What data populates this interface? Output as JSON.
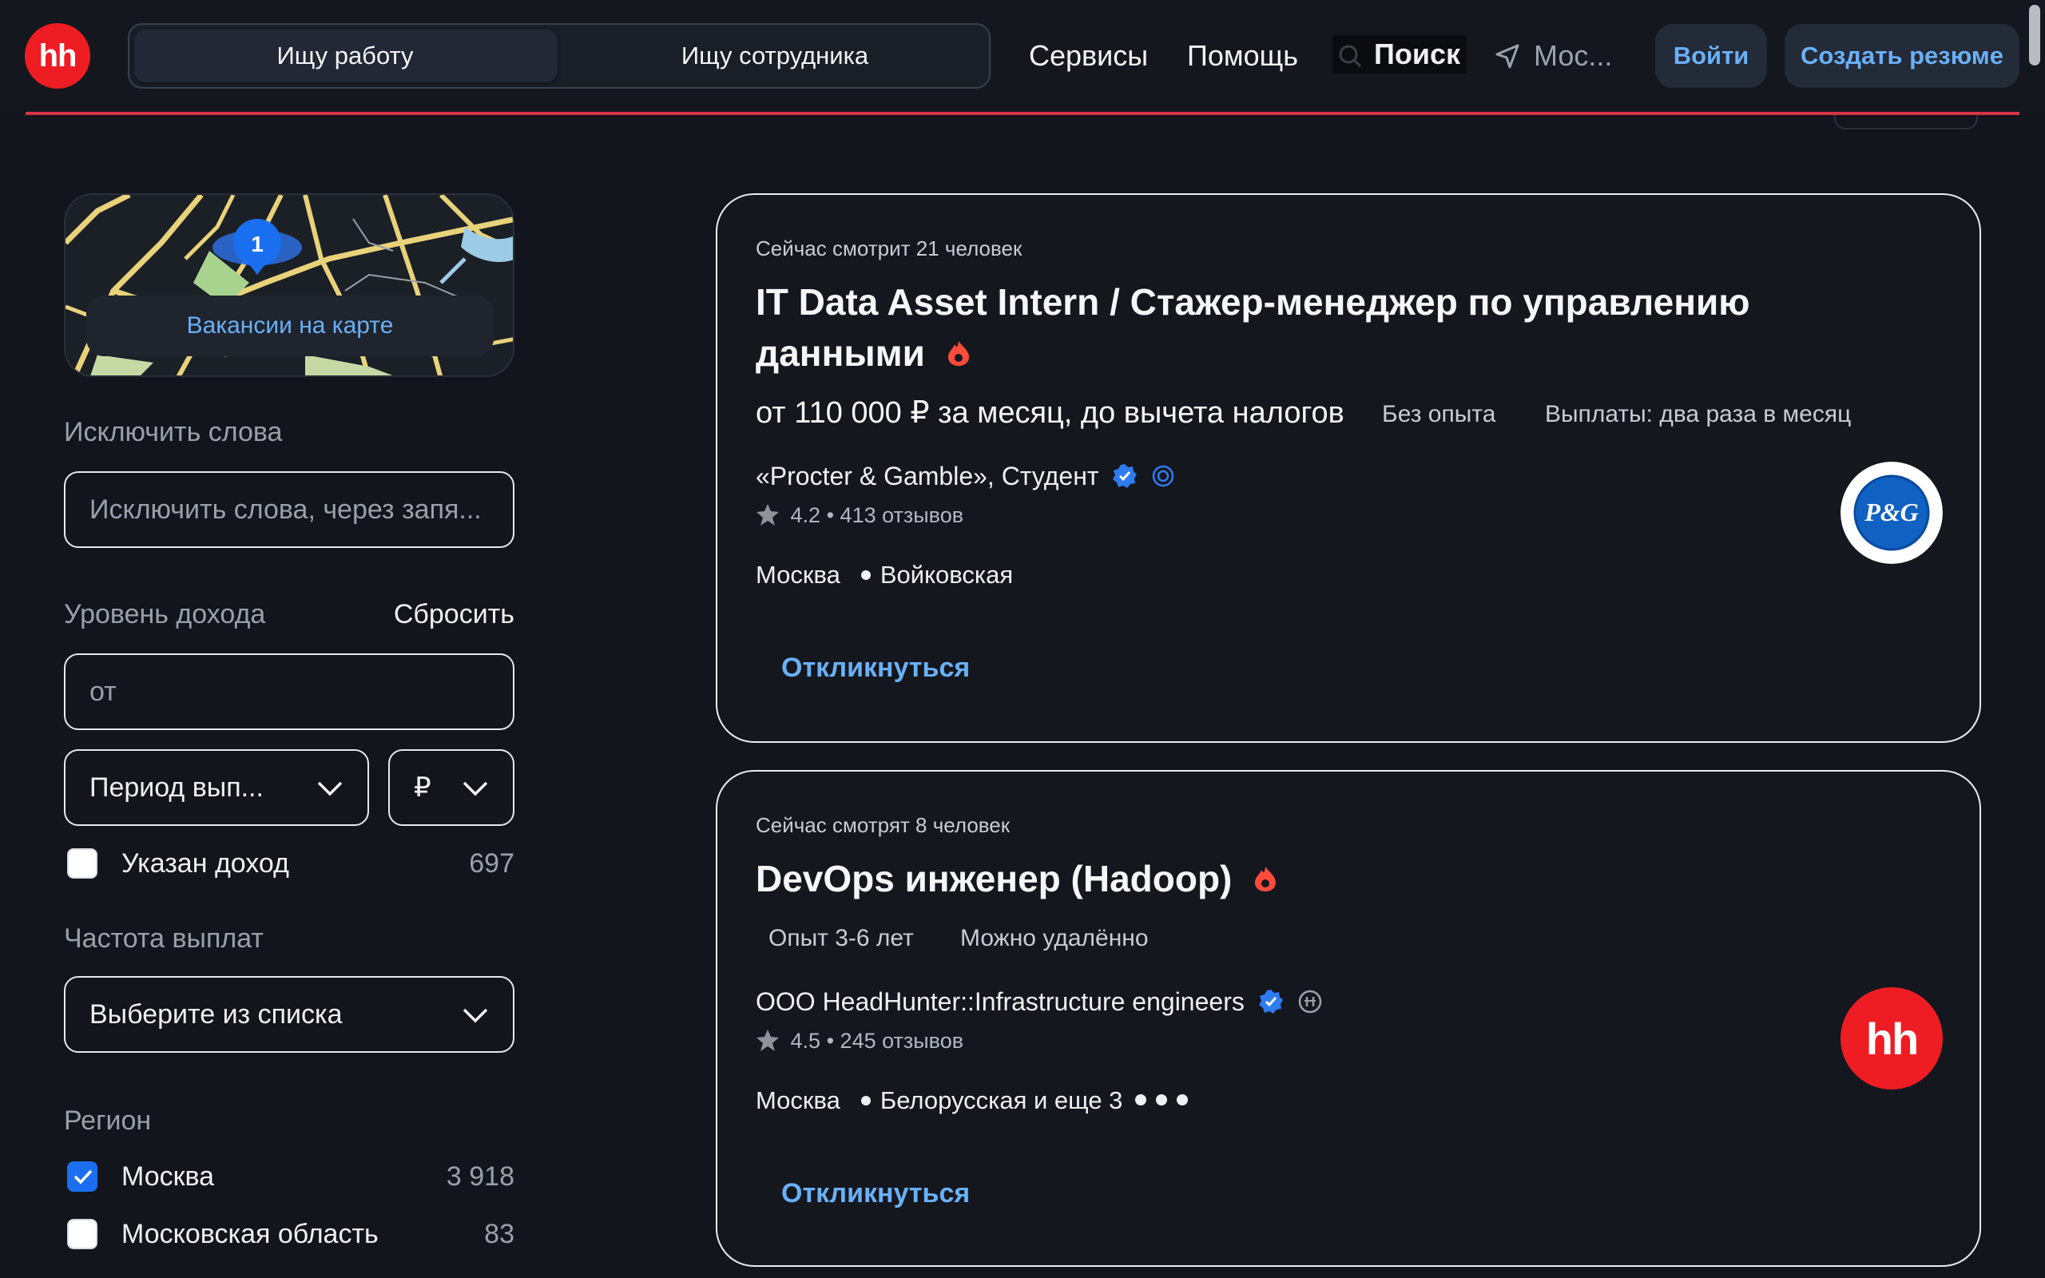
{
  "header": {
    "logo_text": "hh",
    "segment_job_seeker": "Ищу работу",
    "segment_employer": "Ищу сотрудника",
    "nav_services": "Сервисы",
    "nav_help": "Помощь",
    "nav_search": "Поиск",
    "nav_location": "Мос...",
    "login_button": "Войти",
    "create_resume_button": "Создать резюме",
    "colors": {
      "logo_red": "#ee1d23",
      "accent_blue": "#6ab0f5",
      "underline_red": "#d63447"
    }
  },
  "sidebar": {
    "map_badge_count": "1",
    "map_link": "Вакансии на карте",
    "exclude_words_label": "Исключить слова",
    "exclude_words_placeholder": "Исключить слова, через запя...",
    "income_label": "Уровень дохода",
    "income_reset": "Сбросить",
    "income_from_placeholder": "от",
    "pay_period_select": "Период вып...",
    "currency_select": "₽",
    "income_specified_label": "Указан доход",
    "income_specified_count": "697",
    "income_specified_checked": false,
    "payment_frequency_label": "Частота выплат",
    "payment_frequency_select": "Выберите из списка",
    "region_label": "Регион",
    "regions": [
      {
        "name": "Москва",
        "count": "3 918",
        "checked": true
      },
      {
        "name": "Московская область",
        "count": "83",
        "checked": false
      }
    ]
  },
  "vacancies": [
    {
      "viewers": "Сейчас смотрит 21 человек",
      "title_line1": "IT Data Asset Intern / Стажер-менеджер по управлению",
      "title_line2": "данными",
      "salary": "от 110 000 ₽ за месяц, до вычета налогов",
      "experience": "Без опыта",
      "payout": "Выплаты: два раза в месяц",
      "company": "«Procter & Gamble», Студент",
      "rating": "4.2",
      "reviews": "413 отзывов",
      "city": "Москва",
      "metro": "Войковская",
      "respond": "Откликнуться",
      "logo_text": "P&G"
    },
    {
      "viewers": "Сейчас смотрят 8 человек",
      "title": "DevOps инженер (Hadoop)",
      "experience": "Опыт 3-6 лет",
      "remote": "Можно удалённо",
      "company": "ООО HeadHunter::Infrastructure engineers",
      "rating": "4.5",
      "reviews": "245 отзывов",
      "city": "Москва",
      "metro": "Белорусская и еще 3",
      "respond": "Откликнуться",
      "logo_text": "hh"
    }
  ]
}
